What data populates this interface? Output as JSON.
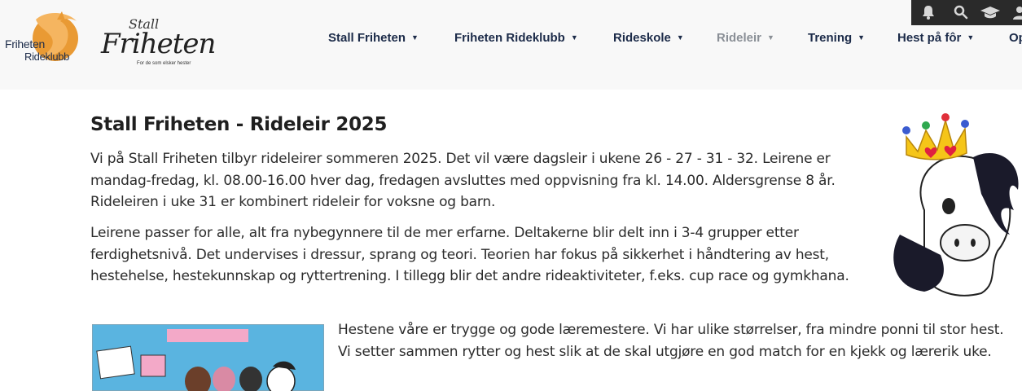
{
  "header": {
    "logo_club": {
      "line1": "Friheten",
      "line2": "Rideklubb"
    },
    "logo_stall": {
      "stall": "Stall",
      "name": "Friheten",
      "tagline": "For de som elsker hester"
    },
    "nav": [
      {
        "label": "Stall Friheten",
        "active": false
      },
      {
        "label": "Friheten Rideklubb",
        "active": false
      },
      {
        "label": "Rideskole",
        "active": false
      },
      {
        "label": "Rideleir",
        "active": true
      },
      {
        "label": "Trening",
        "active": false
      },
      {
        "label": "Hest på fôr",
        "active": false
      },
      {
        "label": "Op",
        "active": false
      }
    ],
    "topbar_icons": [
      "bell-icon",
      "search-icon",
      "graduation-cap-icon",
      "user-icon"
    ]
  },
  "content": {
    "title": "Stall Friheten - Rideleir 2025",
    "paragraphs": [
      "Vi på Stall Friheten tilbyr rideleirer sommeren 2025. Det vil være dagsleir i ukene 26 - 27 - 31 - 32. Leirene er mandag-fredag, kl. 08.00-16.00 hver dag, fredagen avsluttes med oppvisning fra kl. 14.00. Aldersgrense 8 år. Rideleiren i uke 31 er kombinert rideleir for voksne og barn.",
      "Leirene passer for alle, alt fra nybegynnere til de mer erfarne. Deltakerne blir delt inn i 3-4 grupper etter ferdighetsnivå. Det undervises i dressur, sprang og teori. Teorien har fokus på sikkerhet i håndtering av hest, hestehelse, hestekunnskap og ryttertrening. I tillegg blir det andre rideaktiviteter, f.eks. cup race og gymkhana.",
      "Hestene våre er trygge og gode læremestere. Vi har ulike størrelser, fra mindre ponni til stor hest. Vi setter sammen rytter og hest slik at de skal utgjøre en god match for en kjekk og lærerik uke."
    ]
  },
  "colors": {
    "header_bg": "#f8f8f8",
    "nav_text": "#1c2b49",
    "nav_muted": "#8a8f96",
    "topbar_bg": "#2a2a2a",
    "logo_orange": "#e99a34"
  }
}
